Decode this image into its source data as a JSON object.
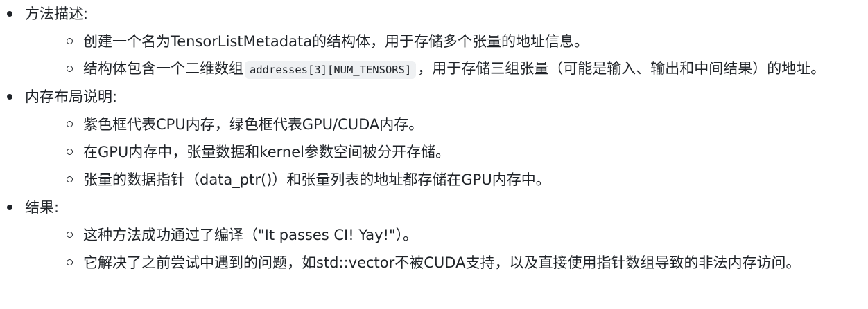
{
  "sections": [
    {
      "heading": "方法描述:",
      "items": [
        {
          "text": "创建一个名为TensorListMetadata的结构体，用于存储多个张量的地址信息。"
        },
        {
          "before": "结构体包含一个二维数组",
          "code": "addresses[3][NUM_TENSORS]",
          "after": "，用于存储三组张量（可能是输入、输出和中间结果）的地址。"
        }
      ]
    },
    {
      "heading": "内存布局说明:",
      "items": [
        {
          "text": "紫色框代表CPU内存，绿色框代表GPU/CUDA内存。"
        },
        {
          "text": "在GPU内存中，张量数据和kernel参数空间被分开存储。"
        },
        {
          "text": "张量的数据指针（data_ptr()）和张量列表的地址都存储在GPU内存中。"
        }
      ]
    },
    {
      "heading": "结果:",
      "items": [
        {
          "text": "这种方法成功通过了编译（\"It passes CI! Yay!\"）。"
        },
        {
          "text": "它解决了之前尝试中遇到的问题，如std::vector不被CUDA支持，以及直接使用指针数组导致的非法内存访问。"
        }
      ]
    }
  ]
}
